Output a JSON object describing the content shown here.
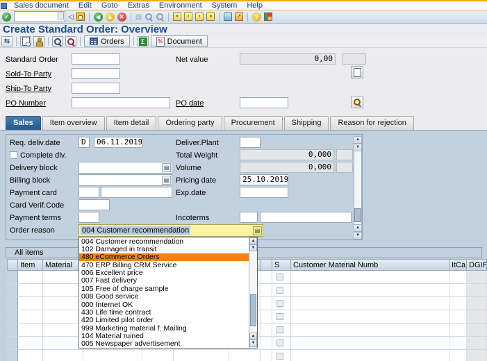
{
  "menubar": {
    "items": [
      "Sales document",
      "Edit",
      "Goto",
      "Extras",
      "Environment",
      "System",
      "Help"
    ]
  },
  "standard_toolbar": {
    "command_value": "",
    "icons": [
      "enter",
      "command-toggle",
      "save",
      "back",
      "exit",
      "cancel",
      "print",
      "find",
      "find-next",
      "first-page",
      "previous-page",
      "next-page",
      "last-page",
      "new-session",
      "create-shortcut",
      "help",
      "customize-layout"
    ]
  },
  "page": {
    "title": "Create Standard Order: Overview"
  },
  "app_toolbar": {
    "icons": [
      "document-flow",
      "display-document",
      "business-partner",
      "search",
      "advanced-search",
      "orders-table",
      "totals-sigma",
      "document-split"
    ],
    "orders_button": "Orders",
    "document_button": "Document"
  },
  "header_form": {
    "standard_order": {
      "label": "Standard Order",
      "value": ""
    },
    "net_value": {
      "label": "Net value",
      "value": "0,00",
      "currency": ""
    },
    "sold_to": {
      "label": "Sold-To Party",
      "value": ""
    },
    "ship_to": {
      "label": "Ship-To Party",
      "value": ""
    },
    "po_number": {
      "label": "PO Number",
      "value": ""
    },
    "po_date": {
      "label": "PO date",
      "value": ""
    }
  },
  "tabs": {
    "items": [
      "Sales",
      "Item overview",
      "Item detail",
      "Ordering party",
      "Procurement",
      "Shipping",
      "Reason for rejection"
    ],
    "active": "Sales"
  },
  "sales_tab": {
    "req_deliv_date": {
      "label": "Req. deliv.date",
      "type": "D",
      "value": "06.11.2019"
    },
    "complete_dlv": {
      "label": "Complete dlv.",
      "checked": false
    },
    "delivery_block": {
      "label": "Delivery block",
      "value": ""
    },
    "billing_block": {
      "label": "Billing block",
      "value": ""
    },
    "payment_card": {
      "label": "Payment card",
      "value": "",
      "value2": ""
    },
    "card_verif_code": {
      "label": "Card Verif.Code",
      "value": ""
    },
    "payment_terms": {
      "label": "Payment terms",
      "value": ""
    },
    "order_reason": {
      "label": "Order reason",
      "value": "004 Customer recommendation"
    },
    "deliver_plant": {
      "label": "Deliver.Plant",
      "value": ""
    },
    "total_weight": {
      "label": "Total Weight",
      "value": "0,000",
      "unit": ""
    },
    "volume": {
      "label": "Volume",
      "value": "0,000",
      "unit": ""
    },
    "pricing_date": {
      "label": "Pricing date",
      "value": "25.10.2019"
    },
    "exp_date": {
      "label": "Exp.date",
      "value": ""
    },
    "incoterms": {
      "label": "Incoterms",
      "value": "",
      "value2": ""
    }
  },
  "order_reason_dropdown": {
    "items": [
      "004 Customer recommendation",
      "102 Damaged in transit",
      "480 eCommerce Orders",
      "470 ERP Billing CRM Service",
      "006 Excellent price",
      "007 Fast delivery",
      "105 Free of charge sample",
      "008 Good service",
      "000 Internet OK",
      "430 Life time contract",
      "420 Limited pilot order",
      "999 Marketing material f. Mailing",
      "104 Material ruined",
      "005 Newspaper advertisement"
    ],
    "highlighted_item": "480 eCommerce Orders",
    "highlighted_index": 2
  },
  "items_table": {
    "section_label": "All items",
    "columns": {
      "item": "Item",
      "material": "Material",
      "s": "S",
      "customer_material": "Customer Material Numb",
      "itca": "ItCa",
      "dgip": "DGIP"
    },
    "visible_row_count": 7,
    "rows": []
  },
  "colors": {
    "active_tab": "#25578c",
    "tab_content_bg": "#c3d0de",
    "highlight_orange": "#f08418",
    "focus_yellow": "#fcf2a2",
    "title_blue": "#1b4f8f",
    "menu_accent_orange": "#f6a800"
  }
}
